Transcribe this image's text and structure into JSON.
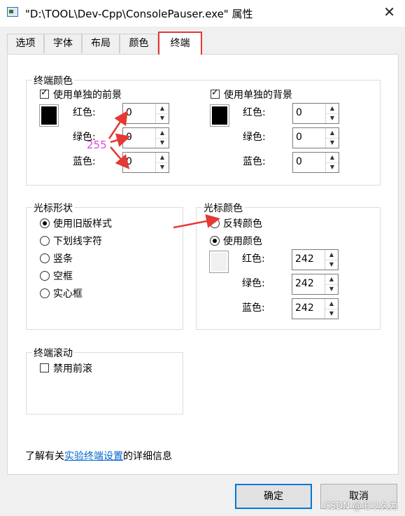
{
  "window": {
    "title": "\"D:\\TOOL\\Dev-Cpp\\ConsolePauser.exe\" 属性",
    "close_label": "✕"
  },
  "tabs": [
    {
      "label": "选项"
    },
    {
      "label": "字体"
    },
    {
      "label": "布局"
    },
    {
      "label": "颜色"
    },
    {
      "label": "终端",
      "active": true
    }
  ],
  "terminal_colors": {
    "legend": "终端颜色",
    "foreground": {
      "checkbox_label": "使用单独的前景",
      "checked": true,
      "red_label": "红色:",
      "red": "0",
      "green_label": "绿色:",
      "green": "0",
      "blue_label": "蓝色:",
      "blue": "0",
      "swatch_color": "#000000"
    },
    "background": {
      "checkbox_label": "使用单独的背景",
      "checked": true,
      "red_label": "红色:",
      "red": "0",
      "green_label": "绿色:",
      "green": "0",
      "blue_label": "蓝色:",
      "blue": "0",
      "swatch_color": "#000000"
    }
  },
  "cursor_shape": {
    "legend": "光标形状",
    "options": [
      {
        "label": "使用旧版样式",
        "selected": true
      },
      {
        "label": "下划线字符",
        "selected": false
      },
      {
        "label": "竖条",
        "selected": false
      },
      {
        "label": "空框",
        "selected": false
      },
      {
        "label": "实心框",
        "selected": false
      }
    ]
  },
  "cursor_color": {
    "legend": "光标颜色",
    "invert_label": "反转颜色",
    "invert_selected": false,
    "use_color_label": "使用颜色",
    "use_color_selected": true,
    "red_label": "红色:",
    "red": "242",
    "green_label": "绿色:",
    "green": "242",
    "blue_label": "蓝色:",
    "blue": "242",
    "swatch_color": "#f2f2f2"
  },
  "terminal_scroll": {
    "legend": "终端滚动",
    "disable_label": "禁用前滚",
    "checked": false
  },
  "info": {
    "prefix": "了解有关",
    "link": "实验终端设置",
    "suffix": "的详细信息"
  },
  "buttons": {
    "ok": "确定",
    "cancel": "取消"
  },
  "annotation": {
    "text": "255",
    "color": "#d64cd6",
    "arrow_color": "#e53935"
  },
  "watermark": "CSDN @モリ久力"
}
